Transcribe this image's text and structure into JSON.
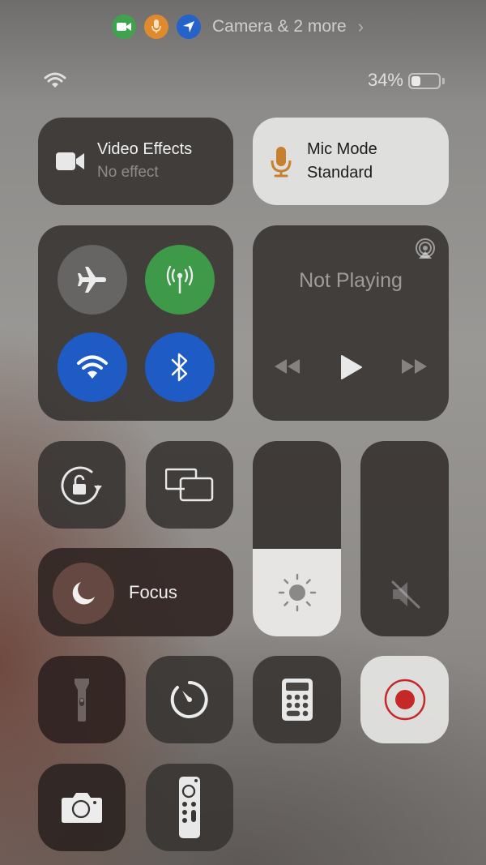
{
  "privacy_indicator": {
    "icons": [
      "camera-icon",
      "microphone-icon",
      "location-icon"
    ],
    "colors": {
      "camera": "#3fa34d",
      "microphone": "#e08a2e",
      "location": "#2563c9"
    },
    "text": "Camera & 2 more",
    "chevron": "›"
  },
  "status_bar": {
    "wifi": "wifi-icon",
    "battery_percent_label": "34%",
    "battery_level": 0.34
  },
  "video_effects": {
    "title": "Video Effects",
    "subtitle": "No effect"
  },
  "mic_mode": {
    "title": "Mic Mode",
    "subtitle": "Standard",
    "icon_color": "#c7812e"
  },
  "connectivity": {
    "airplane": {
      "state": "off",
      "color": "#666564"
    },
    "cellular": {
      "state": "on",
      "color": "#3e9a48"
    },
    "wifi": {
      "state": "on",
      "color": "#1f5bc4"
    },
    "bluetooth": {
      "state": "on",
      "color": "#1f5bc4"
    }
  },
  "now_playing": {
    "title": "Not Playing",
    "controls": [
      "rewind",
      "play",
      "fast-forward"
    ]
  },
  "focus": {
    "label": "Focus"
  },
  "brightness": {
    "level": 0.45
  },
  "volume": {
    "level": 0.0,
    "muted": true
  },
  "controls": [
    {
      "name": "orientation-lock"
    },
    {
      "name": "screen-mirroring"
    },
    {
      "name": "flashlight"
    },
    {
      "name": "timer"
    },
    {
      "name": "calculator"
    },
    {
      "name": "screen-recording",
      "accent": "#c62828"
    },
    {
      "name": "camera"
    },
    {
      "name": "apple-tv-remote"
    }
  ]
}
